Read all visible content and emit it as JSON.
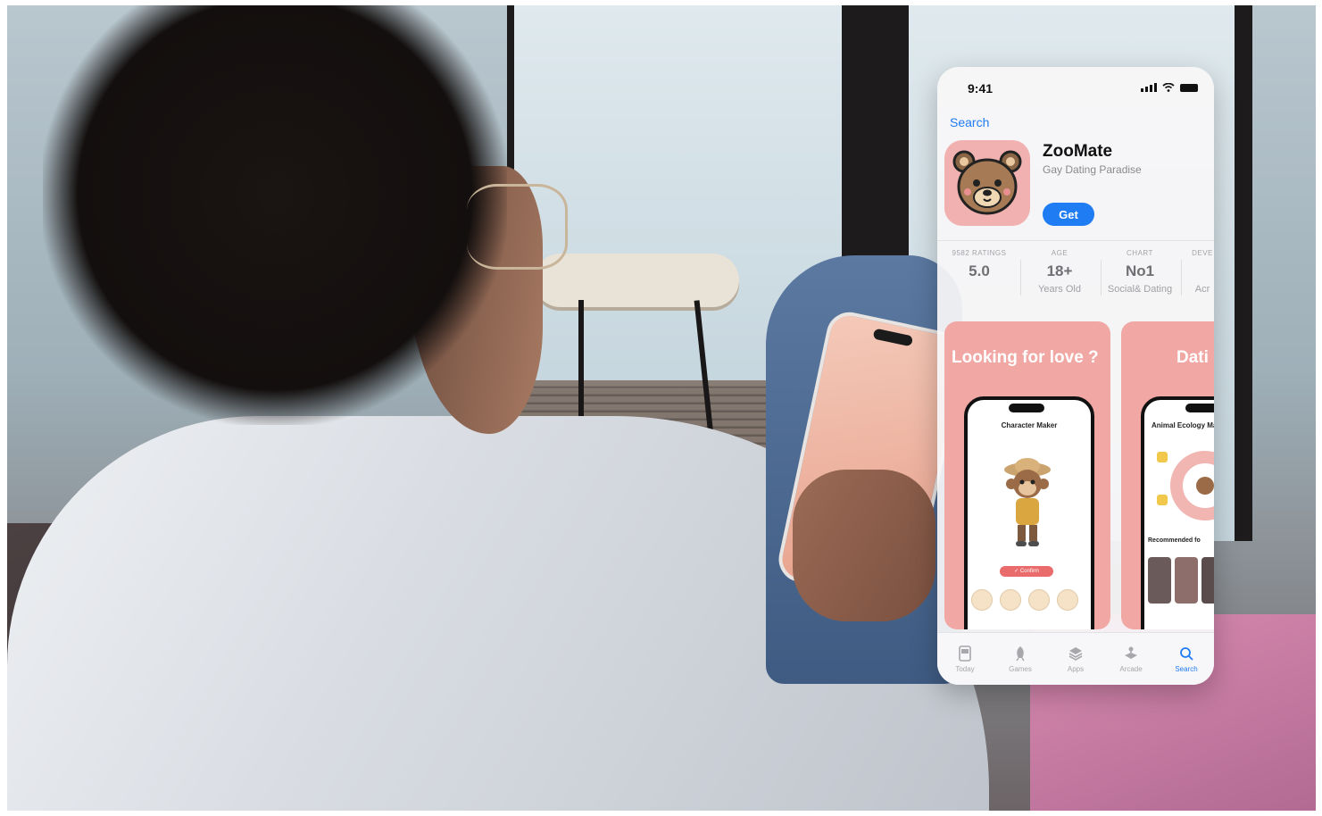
{
  "status_bar": {
    "time": "9:41"
  },
  "nav": {
    "back_label": "Search"
  },
  "app": {
    "name": "ZooMate",
    "subtitle": "Gay Dating Paradise",
    "get_label": "Get"
  },
  "stats": [
    {
      "label": "9582 RATINGS",
      "value": "5.0",
      "detail": ""
    },
    {
      "label": "AGE",
      "value": "18+",
      "detail": "Years Old"
    },
    {
      "label": "CHART",
      "value": "No1",
      "detail": "Social& Dating"
    },
    {
      "label": "DEVE",
      "value": "",
      "detail": "Acr"
    }
  ],
  "screenshots": [
    {
      "headline": "Looking for love ?",
      "screen_title": "Character Maker",
      "button": "✓ Confirm"
    },
    {
      "headline": "Dati",
      "screen_title": "Animal Ecology Map",
      "section": "Recommended fo"
    }
  ],
  "tabbar": [
    {
      "label": "Today",
      "icon": "today-icon",
      "active": false
    },
    {
      "label": "Games",
      "icon": "rocket-icon",
      "active": false
    },
    {
      "label": "Apps",
      "icon": "apps-stack-icon",
      "active": false
    },
    {
      "label": "Arcade",
      "icon": "arcade-icon",
      "active": false
    },
    {
      "label": "Search",
      "icon": "search-icon",
      "active": true
    }
  ],
  "colors": {
    "accent": "#1f7cf2",
    "card_pink": "#f1a8a4",
    "icon_bg": "#f1b1b0"
  }
}
